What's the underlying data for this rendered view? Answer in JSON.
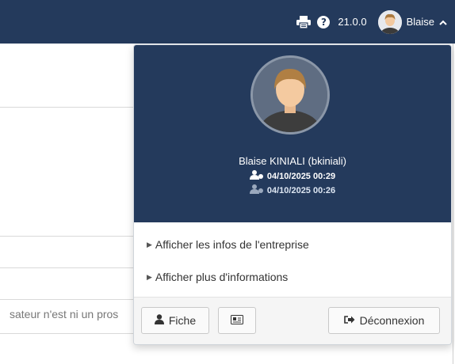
{
  "navbar": {
    "version": "21.0.0",
    "username_short": "Blaise",
    "print_icon": "print-icon",
    "help_icon": "question-circle-icon",
    "chevron_icon": "chevron-up-icon"
  },
  "background": {
    "truncated_text": "sateur n'est ni un pros"
  },
  "profile": {
    "full_name": "Blaise KINIALI (bkiniali)",
    "current_login": "04/10/2025 00:29",
    "previous_login": "04/10/2025 00:26"
  },
  "menu": {
    "company_info": "Afficher les infos de l'entreprise",
    "more_info": "Afficher plus d'informations"
  },
  "footer": {
    "fiche_label": "Fiche",
    "logout_label": "Déconnexion"
  },
  "colors": {
    "navbar": "#243a5c",
    "profile_bg": "#243a5c"
  }
}
